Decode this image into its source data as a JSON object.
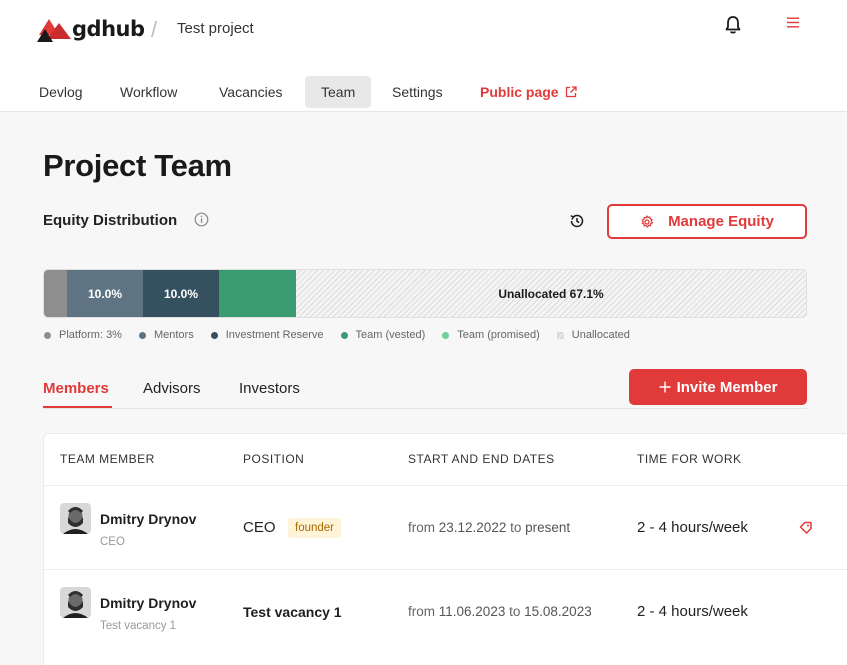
{
  "header": {
    "logo_text": "gdhub",
    "breadcrumb_separator": "/",
    "project_name": "Test project",
    "icons": {
      "notifications": "bell-icon",
      "menu": "hamburger-icon"
    }
  },
  "tabs": [
    {
      "label": "Devlog"
    },
    {
      "label": "Workflow"
    },
    {
      "label": "Vacancies"
    },
    {
      "label": "Team",
      "active": true
    },
    {
      "label": "Settings"
    },
    {
      "label": "Public page",
      "accent": true
    }
  ],
  "main": {
    "title": "Project Team",
    "equity_title": "Equity Distribution",
    "manage_equity_label": "Manage Equity",
    "equity_bar": {
      "mentors_label": "10.0%",
      "reserve_label": "10.0%",
      "unallocated_label": "Unallocated 67.1%"
    },
    "legend": [
      {
        "label": "Platform: 3%",
        "color": "#8e8e8e"
      },
      {
        "label": "Mentors",
        "color": "#5f7483"
      },
      {
        "label": "Investment Reserve",
        "color": "#35505f"
      },
      {
        "label": "Team (vested)",
        "color": "#3a9d71"
      },
      {
        "label": "Team (promised)",
        "color": "#6fcf97"
      },
      {
        "label": "Unallocated",
        "color": "hatched"
      }
    ],
    "sub_tabs": [
      {
        "label": "Members",
        "active": true
      },
      {
        "label": "Advisors"
      },
      {
        "label": "Investors"
      }
    ],
    "invite_label": "Invite Member"
  },
  "table": {
    "headers": [
      "TEAM MEMBER",
      "POSITION",
      "START AND END DATES",
      "TIME FOR WORK"
    ],
    "rows": [
      {
        "name": "Dmitry Drynov",
        "subtitle": "CEO",
        "position": "CEO",
        "badge": "founder",
        "date_from_word": "from",
        "date_start": "23.12.2022",
        "date_to_word": "to",
        "date_end": "present",
        "time": "2 - 4 hours/week"
      },
      {
        "name": "Dmitry Drynov",
        "subtitle": "Test vacancy 1",
        "position": "Test vacancy 1",
        "date_from_word": "from",
        "date_start": "11.06.2023",
        "date_to_word": "to",
        "date_end": "15.08.2023",
        "time": "2 - 4 hours/week"
      }
    ]
  },
  "colors": {
    "accent": "#e03a3a",
    "background": "#f7f7f7"
  }
}
